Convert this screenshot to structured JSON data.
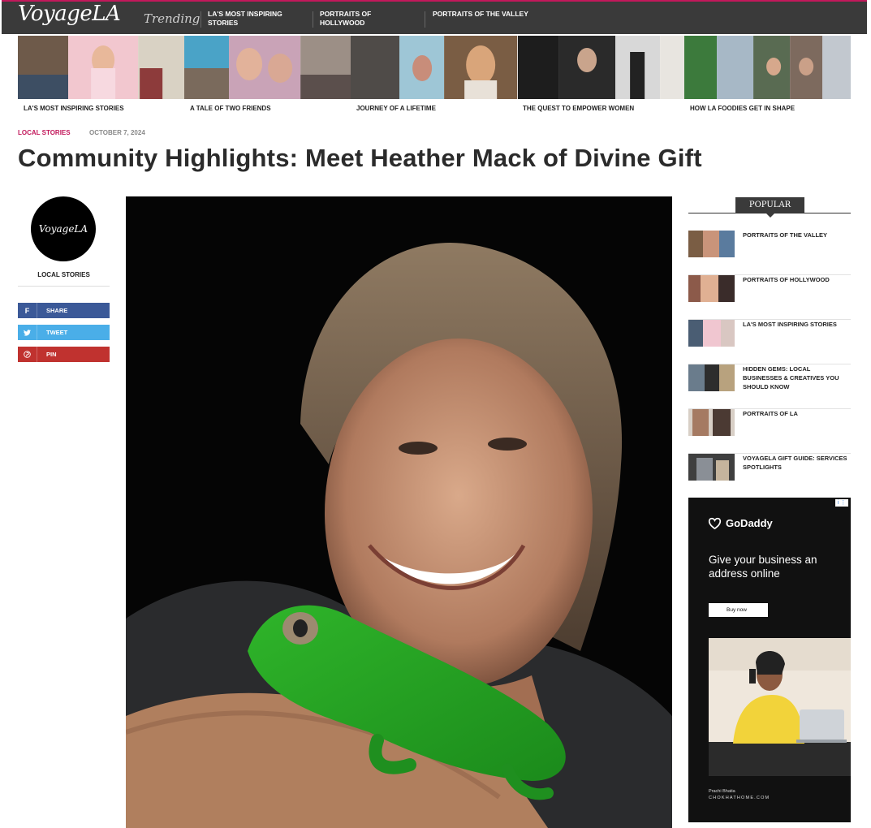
{
  "header": {
    "logo": "VoyageLA",
    "trending_label": "Trending",
    "nav": [
      "LA'S MOST INSPIRING STORIES",
      "PORTRAITS OF HOLLYWOOD",
      "PORTRAITS OF THE VALLEY"
    ]
  },
  "trending_strip": {
    "labels": [
      "LA'S MOST INSPIRING STORIES",
      "A TALE OF TWO FRIENDS",
      "JOURNEY OF A LIFETIME",
      "THE QUEST TO EMPOWER WOMEN",
      "HOW LA FOODIES GET IN SHAPE"
    ]
  },
  "article": {
    "category": "LOCAL STORIES",
    "date": "OCTOBER 7, 2024",
    "title": "Community Highlights: Meet Heather Mack of Divine Gift"
  },
  "left_rail": {
    "avatar_text": "VoyageLA",
    "category": "LOCAL STORIES",
    "share": [
      {
        "label": "SHARE",
        "icon": "facebook-icon",
        "glyph": "f",
        "color": "#3b5998"
      },
      {
        "label": "TWEET",
        "icon": "twitter-icon",
        "glyph": "🐦",
        "color": "#4aaee8"
      },
      {
        "label": "PIN",
        "icon": "pinterest-icon",
        "glyph": "℗",
        "color": "#c0322f"
      }
    ]
  },
  "popular": {
    "heading": "POPULAR",
    "items": [
      "PORTRAITS OF THE VALLEY",
      "PORTRAITS OF HOLLYWOOD",
      "LA'S MOST INSPIRING STORIES",
      "HIDDEN GEMS: LOCAL BUSINESSES & CREATIVES YOU SHOULD KNOW",
      "PORTRAITS OF LA",
      "VOYAGELA GIFT GUIDE: SERVICES SPOTLIGHTS"
    ]
  },
  "ad": {
    "brand": "GoDaddy",
    "headline": "Give your business an address online",
    "button": "Buy now",
    "credit_name": "Prachi Bhatia",
    "credit_site": "CHOKHATHOME.COM",
    "info_badge": "i ⋮"
  },
  "colors": {
    "accent": "#c2185b",
    "nav_bg": "#3a3a3a"
  }
}
